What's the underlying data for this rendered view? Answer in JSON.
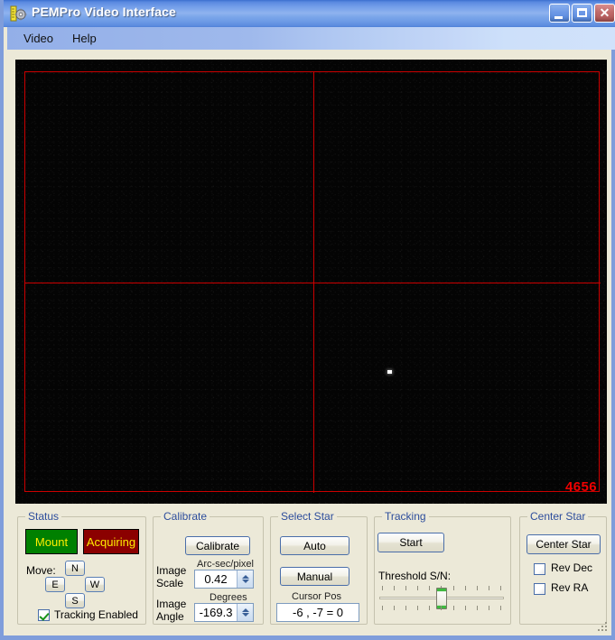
{
  "window": {
    "title": "PEMPro Video Interface",
    "icon": "ruler-gear-icon",
    "minimize_label": "",
    "maximize_label": "",
    "close_label": "✕"
  },
  "menubar": {
    "items": [
      {
        "label": "Video"
      },
      {
        "label": "Help"
      }
    ]
  },
  "video": {
    "counter": "4656",
    "crosshair_color": "#cc0000",
    "background_color": "#040404",
    "star_marker": "star-point"
  },
  "status_group": {
    "legend": "Status",
    "mount_button": "Mount",
    "mount_color": "#008000",
    "acquiring_button": "Acquiring",
    "acquiring_color": "#8b0000",
    "move_label": "Move:",
    "north_button": "N",
    "east_button": "E",
    "west_button": "W",
    "south_button": "S",
    "tracking_checkbox_label": "Tracking Enabled",
    "tracking_checked": true
  },
  "calibrate_group": {
    "legend": "Calibrate",
    "calibrate_button": "Calibrate",
    "image_scale_label_line1": "Image",
    "image_scale_label_line2": "Scale",
    "arcsec_caption": "Arc-sec/pixel",
    "image_scale_value": "0.42",
    "image_angle_label_line1": "Image",
    "image_angle_label_line2": "Angle",
    "degrees_caption": "Degrees",
    "image_angle_value": "-169.3"
  },
  "select_star_group": {
    "legend": "Select Star",
    "auto_button": "Auto",
    "manual_button": "Manual",
    "cursor_pos_caption": "Cursor Pos",
    "cursor_pos_value": "-6 , -7 = 0"
  },
  "tracking_group": {
    "legend": "Tracking",
    "start_button": "Start",
    "threshold_label": "Threshold S/N:",
    "slider_tick_count": 11,
    "slider_thumb_position_percent": 50
  },
  "center_star_group": {
    "legend": "Center Star",
    "center_star_button": "Center Star",
    "rev_dec_label": "Rev Dec",
    "rev_dec_checked": false,
    "rev_ra_label": "Rev RA",
    "rev_ra_checked": false
  }
}
